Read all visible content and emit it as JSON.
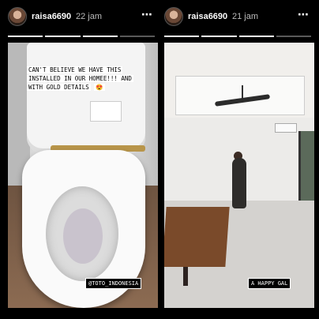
{
  "stories": [
    {
      "username": "raisa6690",
      "time": "22 jam",
      "more_icon": "⋯",
      "caption": "CAN'T BELIEVE WE HAVE THIS INSTALLED IN OUR HOMEE!!! AND WITH GOLD DETAILS",
      "caption_emoji": "😍",
      "tag": "@TOTO_INDONESIA"
    },
    {
      "username": "raisa6690",
      "time": "21 jam",
      "more_icon": "⋯",
      "tag": "A HAPPY GAL"
    }
  ]
}
